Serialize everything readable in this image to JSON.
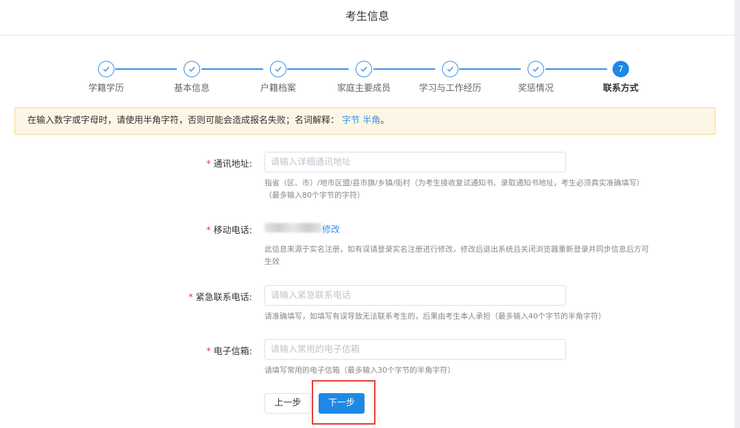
{
  "header": {
    "title": "考生信息"
  },
  "steps": {
    "items": [
      {
        "label": "学籍学历",
        "status": "done"
      },
      {
        "label": "基本信息",
        "status": "done"
      },
      {
        "label": "户籍档案",
        "status": "done"
      },
      {
        "label": "家庭主要成员",
        "status": "done"
      },
      {
        "label": "学习与工作经历",
        "status": "done"
      },
      {
        "label": "奖惩情况",
        "status": "done"
      },
      {
        "label": "联系方式",
        "status": "active",
        "number": "7"
      }
    ]
  },
  "notice": {
    "text": "在输入数字或字母时，请使用半角字符，否则可能会造成报名失败；名词解释：",
    "links": "字节 半角",
    "end": "。"
  },
  "form": {
    "address": {
      "required_mark": "*",
      "label": "通讯地址:",
      "placeholder": "请输入详细通讯地址",
      "hint_line1": "指省（区、市）/地市区盟/县市旗/乡镇/街村（为考生接收复试通知书、录取通知书地址，考生必须真实准确填写）",
      "hint_line2": "（最多输入80个字节的字符）"
    },
    "mobile": {
      "required_mark": "*",
      "label": "移动电话:",
      "modify_label": "修改",
      "hint_line1": "此信息来源于实名注册，如有误请登录实名注册进行修改，修改后退出系统且关闭浏览器重新登录并同步信息后方可",
      "hint_line2": "生效"
    },
    "emergency": {
      "required_mark": "*",
      "label": "紧急联系电话:",
      "placeholder": "请输入紧急联系电话",
      "hint": "请准确填写，如填写有误导致无法联系考生的，后果由考生本人承担（最多输入40个字节的半角字符）"
    },
    "email": {
      "required_mark": "*",
      "label": "电子信箱:",
      "placeholder": "请输入常用的电子信箱",
      "hint": "请填写常用的电子信箱（最多输入30个字节的半角字符）"
    }
  },
  "buttons": {
    "prev": "上一步",
    "next": "下一步"
  },
  "colors": {
    "primary": "#1e88e5",
    "required": "#e53935",
    "notice_bg": "#fdf6e6",
    "highlight": "#e53935"
  }
}
